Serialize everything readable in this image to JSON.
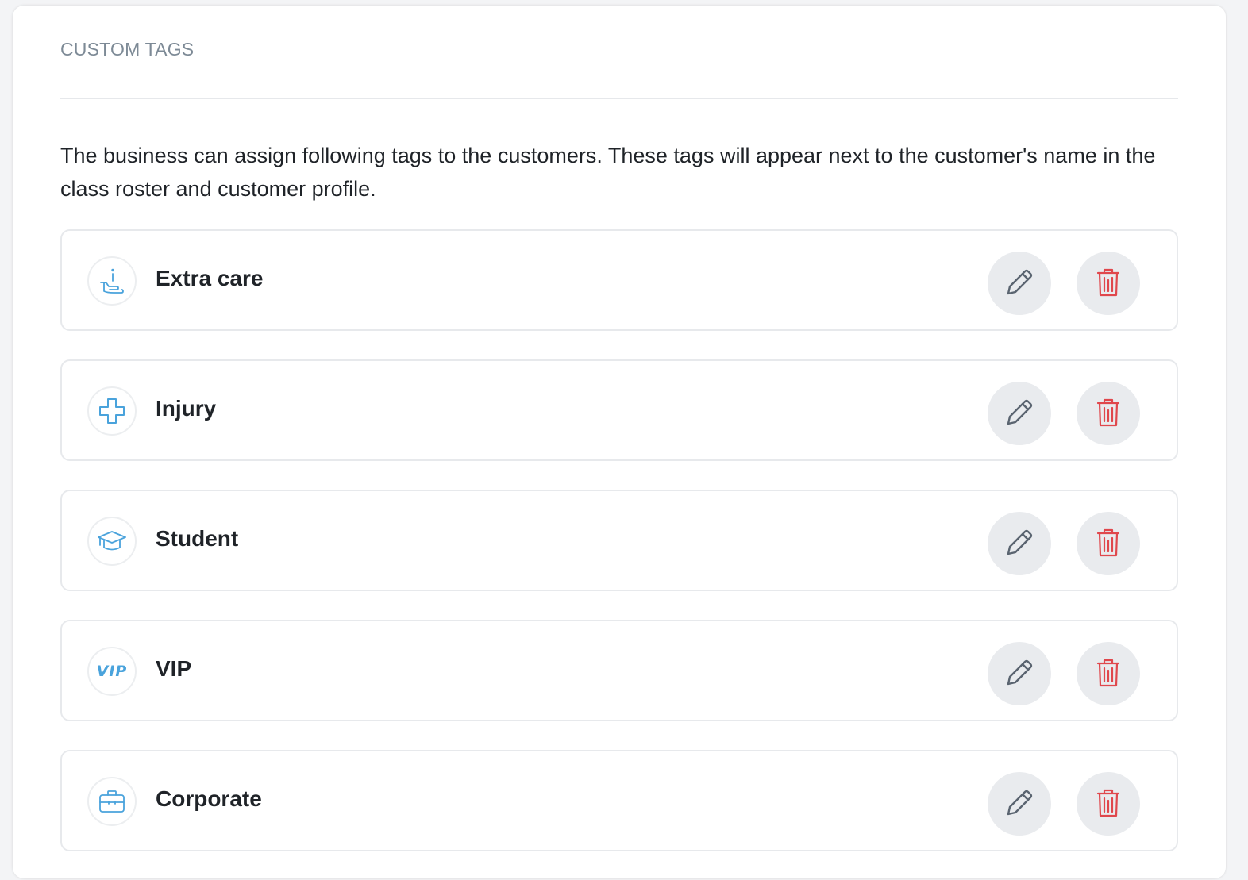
{
  "section": {
    "title": "CUSTOM TAGS",
    "description": "The business can assign following tags to the customers. These tags will appear next to the customer's name in the class roster and customer profile."
  },
  "colors": {
    "accent_icon": "#4aa3dc",
    "delete_icon": "#e0474c",
    "edit_icon": "#5a6470",
    "button_bg": "#e9ebee"
  },
  "tags": [
    {
      "label": "Extra care",
      "icon": "hand-care-icon"
    },
    {
      "label": "Injury",
      "icon": "medical-cross-icon"
    },
    {
      "label": "Student",
      "icon": "graduation-cap-icon"
    },
    {
      "label": "VIP",
      "icon": "vip-icon",
      "icon_text": "VIP"
    },
    {
      "label": "Corporate",
      "icon": "briefcase-icon"
    }
  ]
}
